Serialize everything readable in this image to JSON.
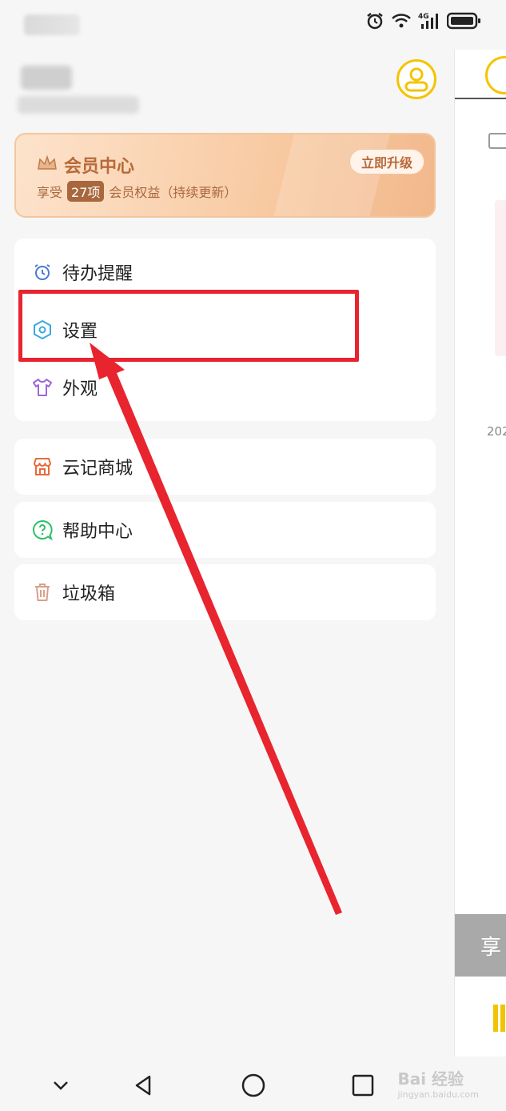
{
  "vip": {
    "title": "会员中心",
    "sub_prefix": "享受",
    "count_badge": "27项",
    "sub_suffix": "会员权益（持续更新）",
    "upgrade_label": "立即升级"
  },
  "menu": {
    "reminder": "待办提醒",
    "settings": "设置",
    "appearance": "外观",
    "store": "云记商城",
    "help": "帮助中心",
    "trash": "垃圾箱"
  },
  "right_panel": {
    "year_fragment": "202",
    "enjoy_fragment": "享"
  },
  "watermark": {
    "main": "Bai 经验",
    "sub": "jingyan.baidu.com"
  },
  "colors": {
    "accent_yellow": "#f4c400",
    "highlight_red": "#e8242f",
    "vip_brown": "#b86a3a"
  }
}
